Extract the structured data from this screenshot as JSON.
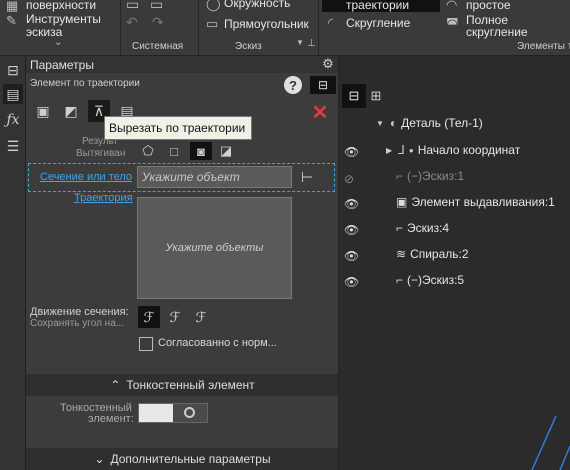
{
  "ribbon": {
    "items": {
      "surfaces": "поверхности",
      "sketch_tools_line1": "Инструменты",
      "sketch_tools_line2": "эскиза",
      "circle": "Окружность",
      "rectangle": "Прямоугольник",
      "trajectory": "траектории",
      "fillet": "Скругление",
      "simple": "простое",
      "full_fillet_line1": "Полное",
      "full_fillet_line2": "скругление"
    },
    "groups": {
      "system": "Системная",
      "sketch": "Эскиз",
      "elements": "Элементы т"
    }
  },
  "panel": {
    "title": "Параметры",
    "subtitle": "Элемент по траектории",
    "result_label_1": "Результ",
    "result_label_2": "Вытягиван",
    "section_label": "Сечение или тело",
    "section_placeholder": "Укажите объект",
    "trajectory_label": "Траектория",
    "trajectory_placeholder": "Укажите объекты",
    "motion_label": "Движение сечения:",
    "keep_angle_label": "Сохранять угол на...",
    "agreed_label": "Согласованно с норм...",
    "thin_section": "Тонкостенный элемент",
    "thin_label_1": "Тонкостенный",
    "thin_label_2": "элемент:",
    "additional_section": "Дополнительные параметры",
    "help_glyph": "?",
    "close_glyph": "✕"
  },
  "tooltip": {
    "text": "Вырезать по траектории"
  },
  "tree": {
    "rows": [
      {
        "label": "Деталь (Тел-1)"
      },
      {
        "label": "Начало координат"
      },
      {
        "label": "(−)Эскиз:1"
      },
      {
        "label": "Элемент выдавливания:1"
      },
      {
        "label": "Эскиз:4"
      },
      {
        "label": "Спираль:2"
      },
      {
        "label": "(−)Эскиз:5"
      }
    ]
  },
  "colors": {
    "accent_link": "#3da6e8",
    "close_red": "#e23b3b",
    "dashed_border": "#3aa7d8",
    "active_icon_bg": "#111111"
  }
}
